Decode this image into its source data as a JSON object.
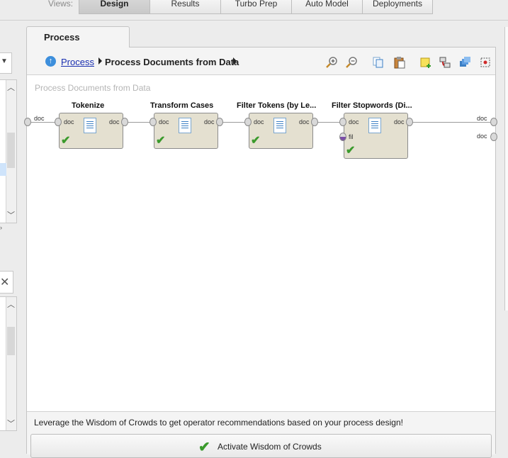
{
  "views": {
    "label": "Views:",
    "tabs": [
      {
        "label": "Design",
        "active": true
      },
      {
        "label": "Results",
        "active": false
      },
      {
        "label": "Turbo Prep",
        "active": false
      },
      {
        "label": "Auto Model",
        "active": false
      },
      {
        "label": "Deployments",
        "active": false
      }
    ]
  },
  "process_panel": {
    "tab_label": "Process",
    "breadcrumb": {
      "root": "Process",
      "current": "Process Documents from Data"
    },
    "toolbar_icons": [
      "zoom-in-icon",
      "zoom-out-icon",
      "copy-icon",
      "paste-icon",
      "add-note-icon",
      "auto-wire-icon",
      "arrange-icon",
      "fit-icon"
    ],
    "canvas_title": "Process Documents from Data",
    "input_port_label": "doc",
    "output_ports": [
      "doc",
      "doc"
    ],
    "operators": [
      {
        "title": "Tokenize",
        "in": "doc",
        "out": "doc",
        "status": "ok"
      },
      {
        "title": "Transform Cases",
        "in": "doc",
        "out": "doc",
        "status": "ok"
      },
      {
        "title": "Filter Tokens (by Le...",
        "in": "doc",
        "out": "doc",
        "status": "ok"
      },
      {
        "title": "Filter Stopwords (Di...",
        "in": "doc",
        "out": "doc",
        "extra_port": "fil",
        "status": "ok"
      }
    ]
  },
  "wisdom": {
    "message": "Leverage the Wisdom of Crowds to get operator recommendations based on your process design!",
    "button_label": "Activate Wisdom of Crowds"
  },
  "colors": {
    "accent_check": "#3a9a2c",
    "operator_fill": "#e4e0d0",
    "link": "#1a2fb0"
  }
}
